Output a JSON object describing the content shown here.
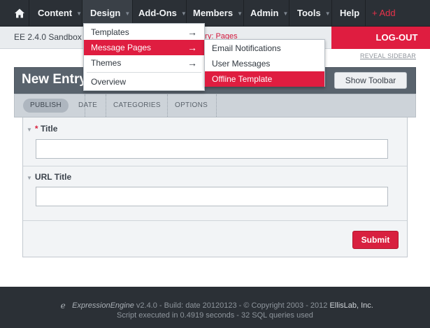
{
  "nav": {
    "content": "Content",
    "design": "Design",
    "addons": "Add-Ons",
    "members": "Members",
    "admin": "Admin",
    "tools": "Tools",
    "help": "Help",
    "add": "+ Add",
    "caret": "▼"
  },
  "subbar": {
    "site_name": "EE 2.4.0 Sandbox",
    "breadcrumb_partial": "atry: Pages",
    "logout": "LOG-OUT",
    "reveal_sidebar": "REVEAL SIDEBAR"
  },
  "panel": {
    "title": "New Entry:",
    "show_toolbar": "Show Toolbar",
    "tabs": [
      "PUBLISH",
      "DATE",
      "CATEGORIES",
      "OPTIONS"
    ]
  },
  "form": {
    "title_required": "*",
    "title_label": "Title",
    "title_value": "",
    "url_title_label": "URL Title",
    "url_title_value": "",
    "submit": "Submit"
  },
  "design_menu": {
    "items": [
      "Templates",
      "Message Pages",
      "Themes",
      "Overview"
    ],
    "arrow": "→"
  },
  "message_pages_menu": {
    "items": [
      "Email Notifications",
      "User Messages",
      "Offline Template"
    ]
  },
  "footer": {
    "logo_glyph": "e",
    "brand": "ExpressionEngine",
    "version_text": "v2.4.0 - Build: date  20120123 - © Copyright 2003 - 2012",
    "company": "EllisLab, Inc.",
    "stats": "Script executed in 0.4919 seconds - 32 SQL queries used"
  },
  "colors": {
    "accent": "#df1d40",
    "nav_bg": "#2b3036",
    "panel_head": "#59636d"
  }
}
